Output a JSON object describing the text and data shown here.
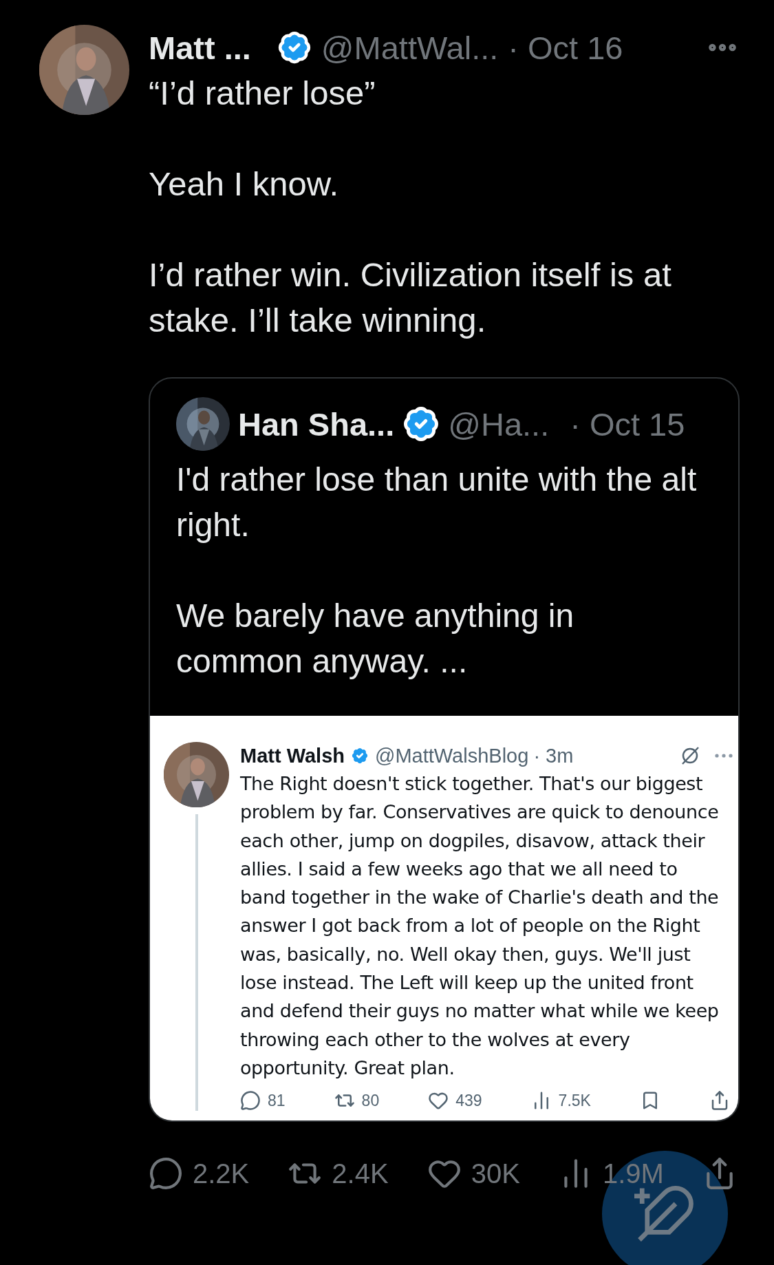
{
  "tweet": {
    "name": "Matt ...",
    "verified": true,
    "handle": "@MattWal...",
    "time": "· Oct 16",
    "paragraphs": [
      "“I’d rather lose”",
      "Yeah I know.",
      "I’d rather win. Civilization itself is at stake. I’ll take winning."
    ],
    "quote": {
      "name": "Han Sha...",
      "verified": true,
      "handle": "@Ha...",
      "time": "· Oct 15",
      "paragraphs": [
        "I'd rather lose than unite with the alt right.",
        "We barely have anything in common anyway. ..."
      ],
      "screenshot": {
        "name": "Matt Walsh",
        "verified": true,
        "handle": "@MattWalshBlog",
        "time": "· 3m",
        "text": "The Right doesn't stick together. That's our biggest problem by far. Conservatives are quick to denounce each other, jump on dogpiles, disavow, attack their allies. I said a few weeks ago that we all need to band together in the wake of Charlie's death and the answer I got back from a lot of people on the Right was, basically, no. Well okay then, guys. We'll just lose instead. The Left will keep up the united front and defend their guys no matter what while we keep throwing each other to the wolves at every opportunity. Great plan.",
        "actions": [
          {
            "kind": "reply",
            "count": "81"
          },
          {
            "kind": "repost",
            "count": "80"
          },
          {
            "kind": "like",
            "count": "439"
          },
          {
            "kind": "views",
            "count": "7.5K"
          },
          {
            "kind": "bookmark"
          },
          {
            "kind": "share"
          }
        ]
      }
    },
    "actions": [
      {
        "kind": "reply",
        "count": "2.2K"
      },
      {
        "kind": "repost",
        "count": "2.4K"
      },
      {
        "kind": "like",
        "count": "30K"
      },
      {
        "kind": "views",
        "count": "1.9M"
      },
      {
        "kind": "share"
      }
    ]
  }
}
